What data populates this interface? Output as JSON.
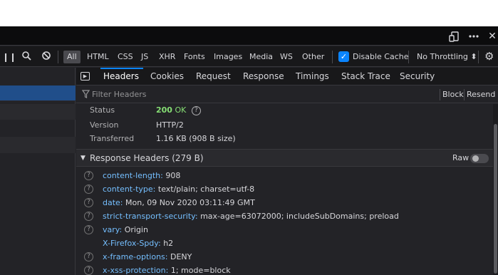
{
  "window": {
    "responsive_icon": "responsive-design-icon",
    "menu_icon": "more-options-icon",
    "close_glyph": "✕"
  },
  "toolbar": {
    "filters": [
      "All",
      "HTML",
      "CSS",
      "JS",
      "XHR",
      "Fonts",
      "Images",
      "Media",
      "WS",
      "Other"
    ],
    "disable_cache_label": "Disable Cache",
    "disable_cache_checked": true,
    "throttling_label": "No Throttling ⬍"
  },
  "details": {
    "tabs": [
      "Headers",
      "Cookies",
      "Request",
      "Response",
      "Timings",
      "Stack Trace",
      "Security"
    ],
    "active_tab": "Headers",
    "filter_placeholder": "Filter Headers",
    "block_label": "Block",
    "resend_label": "Resend ▾"
  },
  "summary": {
    "status_label": "Status",
    "status_code": "200",
    "status_text": "OK",
    "version_label": "Version",
    "version_value": "HTTP/2",
    "transferred_label": "Transferred",
    "transferred_value": "1.16 KB (908 B size)"
  },
  "response_headers": {
    "title": "Response Headers (279 B)",
    "raw_label": "Raw",
    "raw_enabled": false,
    "rows": [
      {
        "name": "content-length:",
        "value": "908",
        "help": true
      },
      {
        "name": "content-type:",
        "value": "text/plain; charset=utf-8",
        "help": true
      },
      {
        "name": "date:",
        "value": "Mon, 09 Nov 2020 03:11:49 GMT",
        "help": true
      },
      {
        "name": "strict-transport-security:",
        "value": "max-age=63072000; includeSubDomains; preload",
        "help": true
      },
      {
        "name": "vary:",
        "value": "Origin",
        "help": true
      },
      {
        "name": "X-Firefox-Spdy:",
        "value": "h2",
        "help": false
      },
      {
        "name": "x-frame-options:",
        "value": "DENY",
        "help": true
      },
      {
        "name": "x-xss-protection:",
        "value": "1; mode=block",
        "help": true
      }
    ]
  },
  "colors": {
    "accent": "#0a84ff",
    "status_ok": "#86de74",
    "header_name": "#75bfff",
    "panel_bg": "#232327"
  }
}
